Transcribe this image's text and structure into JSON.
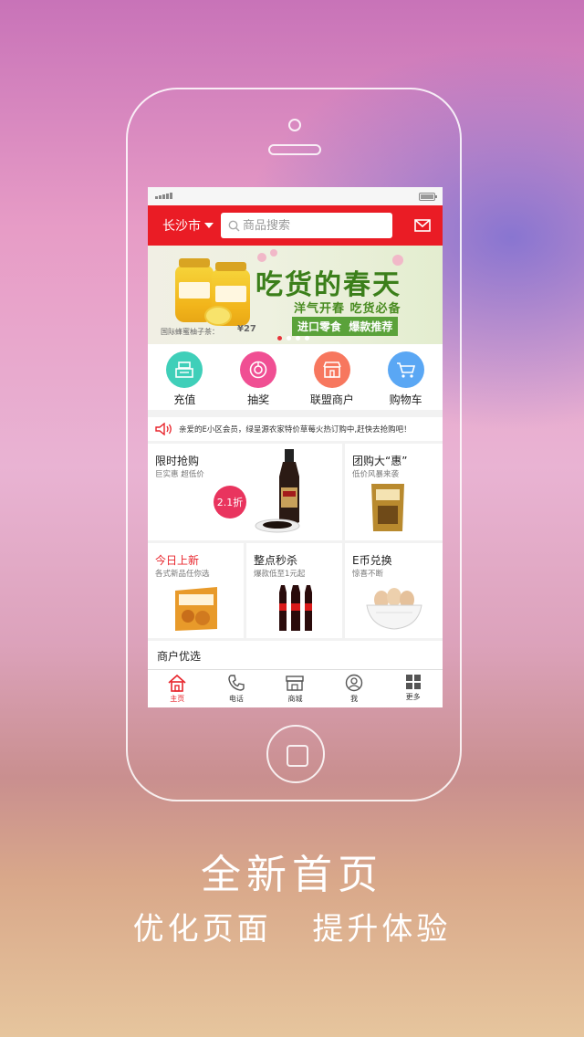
{
  "header": {
    "city": "长沙市",
    "search_placeholder": "商品搜索"
  },
  "banner": {
    "title": "吃货的春天",
    "subtitle": "洋气开春  吃货必备",
    "tag_left": "进口零食",
    "tag_right": "爆款推荐",
    "product_caption": "国际蜂蜜柚子茶：",
    "price": "¥27",
    "slide_count": 4,
    "active_slide": 1
  },
  "quick_actions": [
    {
      "label": "充值",
      "color": "#3fcfb9"
    },
    {
      "label": "抽奖",
      "color": "#f04f93"
    },
    {
      "label": "联盟商户",
      "color": "#f7775e"
    },
    {
      "label": "购物车",
      "color": "#5aa7f4"
    }
  ],
  "notice": {
    "text": "亲爱的E小区会员，绿呈源农家特价草莓火热订购中,赶快去抢购吧！"
  },
  "promo": {
    "flash": {
      "title": "限时抢购",
      "sub": "巨实惠 超低价",
      "badge": "2.1折"
    },
    "group": {
      "title": "团购大“惠”",
      "sub": "低价风暴来袭"
    },
    "new": {
      "title": "今日上新",
      "sub": "各式新品任你选"
    },
    "hourly": {
      "title": "整点秒杀",
      "sub": "爆款低至1元起"
    },
    "exchange": {
      "title": "E币兑换",
      "sub": "惊喜不断"
    }
  },
  "section": {
    "merchant_title": "商户优选"
  },
  "tabbar": [
    {
      "label": "主页",
      "active": true
    },
    {
      "label": "电话",
      "active": false
    },
    {
      "label": "商城",
      "active": false
    },
    {
      "label": "我",
      "active": false
    },
    {
      "label": "更多",
      "active": false
    }
  ],
  "slogan": {
    "line1": "全新首页",
    "line2a": "优化页面",
    "line2b": "提升体验"
  },
  "colors": {
    "brand_red": "#ea1c25",
    "accent_red": "#e8242b",
    "badge_pink": "#e9345e"
  }
}
